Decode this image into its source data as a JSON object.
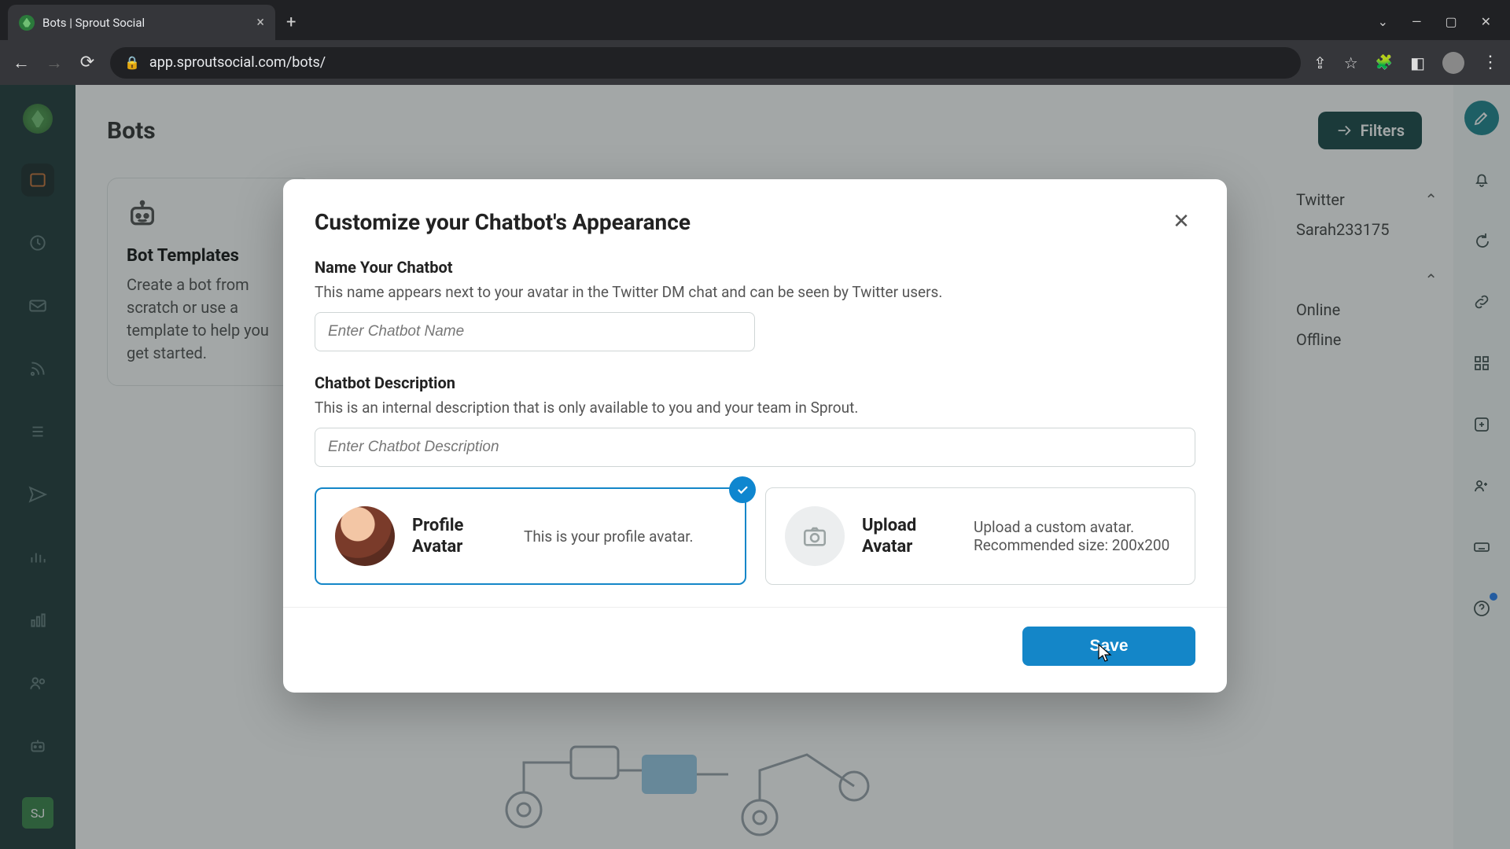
{
  "browser": {
    "tab_title": "Bots | Sprout Social",
    "url": "app.sproutsocial.com/bots/"
  },
  "page": {
    "title": "Bots",
    "filters_label": "Filters",
    "templates": {
      "heading": "Bot Templates",
      "description": "Create a bot from scratch or use a template to help you get started."
    },
    "sidepanel": {
      "platform_label": "Twitter",
      "handle": "Sarah233175",
      "status_online": "Online",
      "status_offline": "Offline"
    }
  },
  "leftnav": {
    "badge": "SJ"
  },
  "modal": {
    "title": "Customize your Chatbot's Appearance",
    "name": {
      "label": "Name Your Chatbot",
      "desc": "This name appears next to your avatar in the Twitter DM chat and can be seen by Twitter users.",
      "placeholder": "Enter Chatbot Name"
    },
    "description": {
      "label": "Chatbot Description",
      "desc": "This is an internal description that is only available to you and your team in Sprout.",
      "placeholder": "Enter Chatbot Description"
    },
    "avatar_profile": {
      "title": "Profile Avatar",
      "desc": "This is your profile avatar."
    },
    "avatar_upload": {
      "title": "Upload Avatar",
      "desc": "Upload a custom avatar. Recommended size: 200x200"
    },
    "save_label": "Save"
  }
}
